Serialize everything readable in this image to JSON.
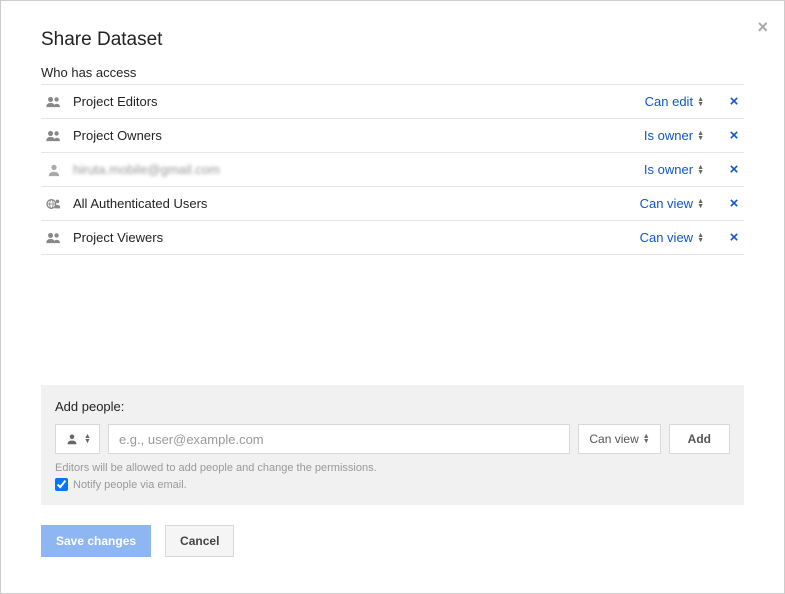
{
  "dialog": {
    "title": "Share Dataset",
    "close_label": "×"
  },
  "access_section": {
    "label": "Who has access"
  },
  "access_list": [
    {
      "icon": "group",
      "name": "Project Editors",
      "permission": "Can edit",
      "blurred": false
    },
    {
      "icon": "group",
      "name": "Project Owners",
      "permission": "Is owner",
      "blurred": false
    },
    {
      "icon": "person",
      "name": "hiruta.mobile@gmail.com",
      "permission": "Is owner",
      "blurred": true
    },
    {
      "icon": "globe",
      "name": "All Authenticated Users",
      "permission": "Can view",
      "blurred": false
    },
    {
      "icon": "group",
      "name": "Project Viewers",
      "permission": "Can view",
      "blurred": false
    }
  ],
  "add_people": {
    "label": "Add people:",
    "placeholder": "e.g., user@example.com",
    "permission_default": "Can view",
    "add_button": "Add",
    "helper_text": "Editors will be allowed to add people and change the permissions.",
    "notify_label": "Notify people via email.",
    "notify_checked": true
  },
  "buttons": {
    "save": "Save changes",
    "cancel": "Cancel"
  },
  "remove_symbol": "×"
}
